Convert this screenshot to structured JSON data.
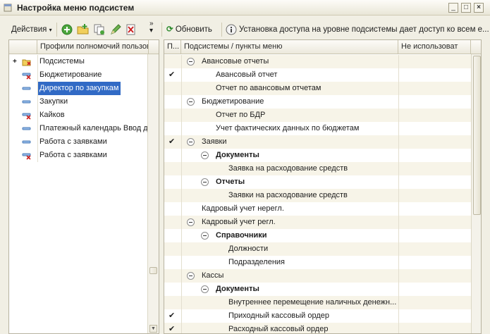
{
  "window": {
    "title": "Настройка меню подсистем"
  },
  "toolbar": {
    "actions_label": "Действия",
    "refresh_label": "Обновить",
    "info_text": "Установка доступа на уровне подсистемы дает доступ ко всем е..."
  },
  "left_grid": {
    "header": "Профили полномочий пользов",
    "rows": [
      {
        "label": "Подсистемы",
        "icon": "folder-denied-icon"
      },
      {
        "label": "Бюджетирование",
        "icon": "item-denied-icon"
      },
      {
        "label": "Директор по закупкам",
        "icon": "item-icon",
        "selected": true
      },
      {
        "label": "Закупки",
        "icon": "item-icon"
      },
      {
        "label": "Кайков",
        "icon": "item-denied-icon"
      },
      {
        "label": "Платежный календарь Ввод д",
        "icon": "item-icon"
      },
      {
        "label": "Работа с заявками",
        "icon": "item-icon"
      },
      {
        "label": "Работа с заявками",
        "icon": "item-denied-icon"
      }
    ]
  },
  "right_grid": {
    "headers": {
      "p": "П...",
      "name": "Подсистемы / пункты меню",
      "not_used": "Не использоват"
    },
    "rows": [
      {
        "label": "Авансовые отчеты",
        "level": 1,
        "toggle": true,
        "checked": false,
        "bold": false
      },
      {
        "label": "Авансовый отчет",
        "level": 2,
        "toggle": false,
        "checked": true,
        "bold": false
      },
      {
        "label": "Отчет по авансовым отчетам",
        "level": 2,
        "toggle": false,
        "checked": false,
        "bold": false
      },
      {
        "label": "Бюджетирование",
        "level": 1,
        "toggle": true,
        "checked": false,
        "bold": false
      },
      {
        "label": "Отчет по БДР",
        "level": 2,
        "toggle": false,
        "checked": false,
        "bold": false
      },
      {
        "label": "Учет фактических данных по бюджетам",
        "level": 2,
        "toggle": false,
        "checked": false,
        "bold": false
      },
      {
        "label": "Заявки",
        "level": 1,
        "toggle": true,
        "checked": true,
        "bold": false
      },
      {
        "label": "Документы",
        "level": 2,
        "toggle": true,
        "checked": false,
        "bold": true
      },
      {
        "label": "Заявка на расходование средств",
        "level": 3,
        "toggle": false,
        "checked": false,
        "bold": false
      },
      {
        "label": "Отчеты",
        "level": 2,
        "toggle": true,
        "checked": false,
        "bold": true
      },
      {
        "label": "Заявки на расходование средств",
        "level": 3,
        "toggle": false,
        "checked": false,
        "bold": false
      },
      {
        "label": "Кадровый учет нерегл.",
        "level": 1,
        "toggle": false,
        "checked": false,
        "bold": false
      },
      {
        "label": "Кадровый учет регл.",
        "level": 1,
        "toggle": true,
        "checked": false,
        "bold": false
      },
      {
        "label": "Справочники",
        "level": 2,
        "toggle": true,
        "checked": false,
        "bold": true
      },
      {
        "label": "Должности",
        "level": 3,
        "toggle": false,
        "checked": false,
        "bold": false
      },
      {
        "label": "Подразделения",
        "level": 3,
        "toggle": false,
        "checked": false,
        "bold": false
      },
      {
        "label": "Кассы",
        "level": 1,
        "toggle": true,
        "checked": false,
        "bold": false
      },
      {
        "label": "Документы",
        "level": 2,
        "toggle": true,
        "checked": false,
        "bold": true
      },
      {
        "label": "Внутреннее перемещение наличных денежн...",
        "level": 3,
        "toggle": false,
        "checked": false,
        "bold": false
      },
      {
        "label": "Приходный кассовый ордер",
        "level": 3,
        "toggle": false,
        "checked": true,
        "bold": false
      },
      {
        "label": "Расходный кассовый ордер",
        "level": 3,
        "toggle": false,
        "checked": true,
        "bold": false
      }
    ]
  }
}
